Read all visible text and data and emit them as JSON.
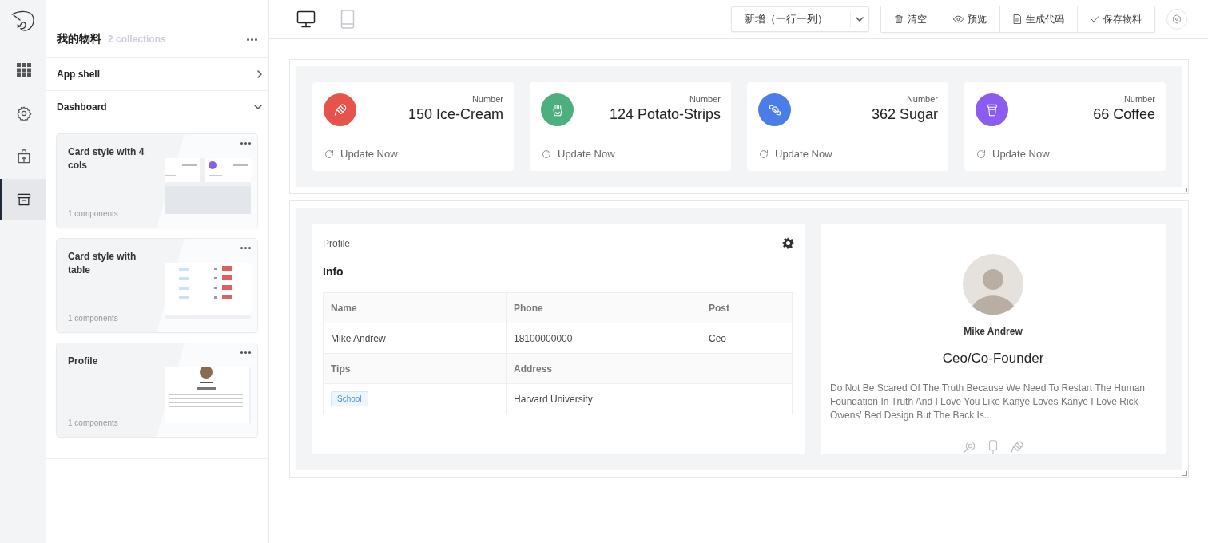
{
  "rail": {
    "items": [
      {
        "kind": "grid",
        "selected": false
      },
      {
        "kind": "gear",
        "selected": false
      },
      {
        "kind": "bag-upload",
        "selected": false
      },
      {
        "kind": "archive",
        "selected": true
      }
    ]
  },
  "materials": {
    "title": "我的物料",
    "count": "2 collections",
    "groups": [
      {
        "label": "App shell",
        "expanded": false
      },
      {
        "label": "Dashboard",
        "expanded": true,
        "children": [
          {
            "title": "Card style with 4 cols",
            "count": "1 components",
            "kind": "cards"
          },
          {
            "title": "Card style with table",
            "count": "1 components",
            "kind": "table"
          },
          {
            "title": "Profile",
            "count": "1 components",
            "kind": "profile"
          }
        ]
      }
    ]
  },
  "toolbar": {
    "devices": [
      {
        "kind": "desktop",
        "selected": true
      },
      {
        "kind": "tablet",
        "selected": false
      }
    ],
    "add_select": {
      "value": "新增（一行一列）"
    },
    "actions": [
      {
        "kind": "trash",
        "label": "清空"
      },
      {
        "kind": "eye",
        "label": "预览"
      },
      {
        "kind": "file",
        "label": "生成代码"
      },
      {
        "kind": "check",
        "label": "保存物料"
      }
    ]
  },
  "stat_cards": [
    {
      "kind": "ice-cream",
      "color": "#e5534b",
      "caption": "Number",
      "value": "150 Ice-Cream",
      "action": "Update Now"
    },
    {
      "kind": "fries",
      "color": "#4caf7d",
      "caption": "Number",
      "value": "124 Potato-Strips",
      "action": "Update Now"
    },
    {
      "kind": "candy",
      "color": "#4a7de8",
      "caption": "Number",
      "value": "362 Sugar",
      "action": "Update Now"
    },
    {
      "kind": "cup",
      "color": "#8a5cf0",
      "caption": "Number",
      "value": "66 Coffee",
      "action": "Update Now"
    }
  ],
  "info_panel": {
    "caption": "Profile",
    "heading": "Info",
    "table": {
      "rows": [
        {
          "kind": "head",
          "cells": [
            "Name",
            "Phone",
            "Post"
          ]
        },
        {
          "kind": "body",
          "cells": [
            "Mike Andrew",
            "18100000000",
            "Ceo"
          ]
        },
        {
          "kind": "head",
          "cells": [
            "Tips",
            "Address"
          ]
        },
        {
          "kind": "tagged",
          "cells": [
            "School",
            "Harvard University"
          ]
        }
      ]
    }
  },
  "profile_card": {
    "name": "Mike Andrew",
    "title": "Ceo/Co-Founder",
    "bio": "Do Not Be Scared Of The Truth Because We Need To Restart The Human Foundation In Truth And I Love You Like Kanye Loves Kanye I Love Rick Owens' Bed Design But The Back Is..."
  }
}
